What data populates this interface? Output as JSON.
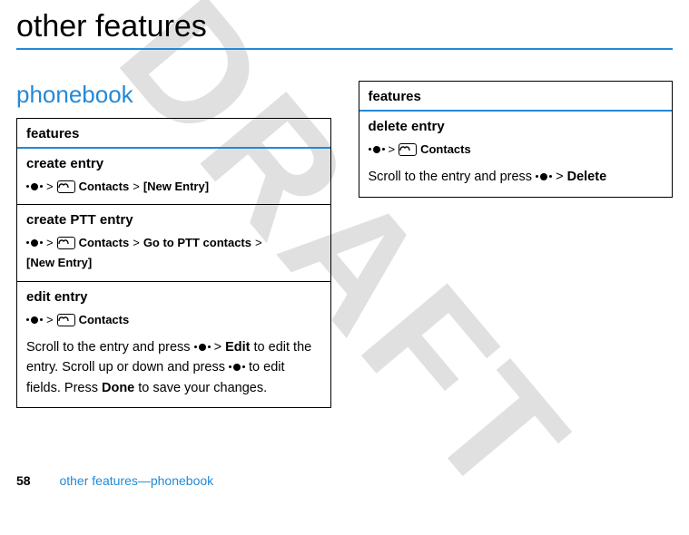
{
  "watermark": "DRAFT",
  "page_title": "other features",
  "section_title": "phonebook",
  "left_box": {
    "header": "features",
    "entries": [
      {
        "title": "create entry",
        "seq": [
          "nav",
          ">",
          "book",
          "Contacts",
          ">",
          "[New Entry]"
        ]
      },
      {
        "title": "create PTT entry",
        "seq": [
          "nav",
          ">",
          "book",
          "Contacts",
          ">",
          "Go to PTT contacts",
          ">",
          "[New Entry]"
        ]
      },
      {
        "title": "edit entry",
        "seq": [
          "nav",
          ">",
          "book",
          "Contacts"
        ],
        "desc_parts": [
          {
            "t": "Scroll to the entry and press "
          },
          {
            "icon": "nav"
          },
          {
            "t": " > "
          },
          {
            "b": "Edit"
          },
          {
            "t": " to edit the entry. Scroll up or down and press "
          },
          {
            "icon": "nav"
          },
          {
            "t": " to edit fields. Press "
          },
          {
            "b": "Done"
          },
          {
            "t": " to save your changes."
          }
        ]
      }
    ]
  },
  "right_box": {
    "header": "features",
    "entries": [
      {
        "title": "delete entry",
        "seq": [
          "nav",
          ">",
          "book",
          "Contacts"
        ],
        "desc_parts": [
          {
            "t": "Scroll to the entry and press "
          },
          {
            "icon": "nav"
          },
          {
            "t": " > "
          },
          {
            "b": "Delete"
          }
        ]
      }
    ]
  },
  "footer": {
    "page": "58",
    "crumb": "other features—phonebook"
  }
}
